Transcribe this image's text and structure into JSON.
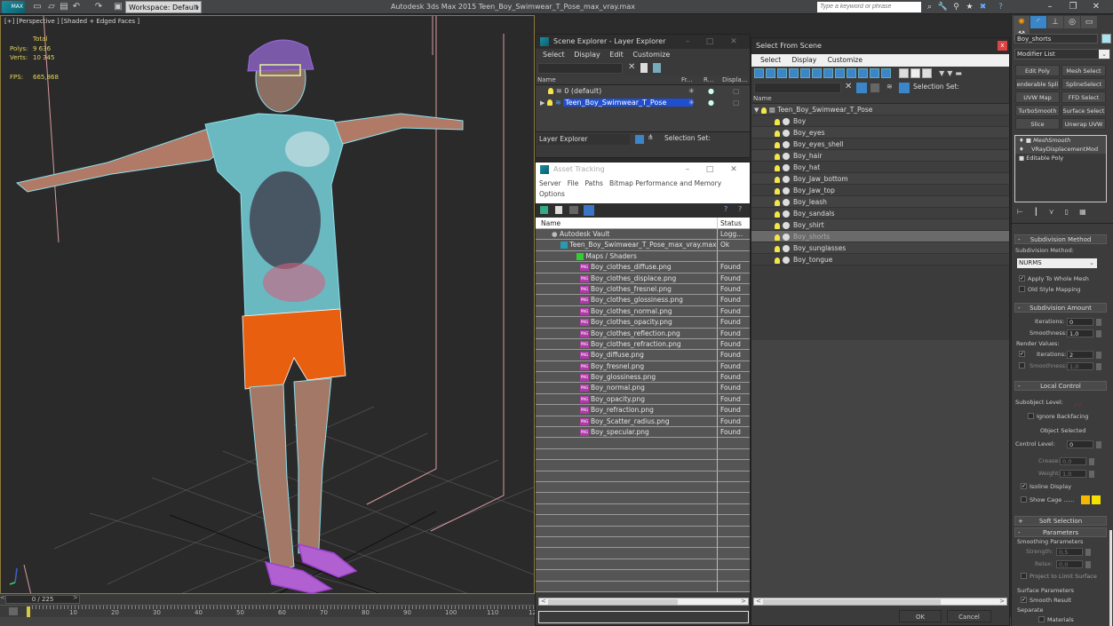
{
  "titlebar": {
    "logo": "MAX",
    "workspace": "Workspace: Default",
    "app_title": "Autodesk 3ds Max  2015     Teen_Boy_Swimwear_T_Pose_max_vray.max",
    "search_placeholder": "Type a keyword or phrase",
    "tool_icons": [
      "binoculars-icon",
      "wrench-icon",
      "satellite-icon",
      "star-icon",
      "exchange-icon",
      "help-icon"
    ],
    "window_controls": [
      "–",
      "❐",
      "✕"
    ]
  },
  "viewport": {
    "label": "[+] [Perspective ] [Shaded + Edged Faces ]",
    "stats": {
      "header": "Total",
      "polys_label": "Polys:",
      "polys": "9 636",
      "verts_label": "Verts:",
      "verts": "10 345",
      "fps_label": "FPS:",
      "fps": "665,868"
    },
    "colors": {
      "shorts": "#e8600f",
      "wire": "#7fe0ee",
      "sandals": "#a040d0",
      "skin": "#b0806a"
    }
  },
  "timeline": {
    "frame": "0 / 225",
    "ticks": [
      "10",
      "20",
      "30",
      "40",
      "50",
      "60",
      "70",
      "80",
      "90",
      "100",
      "110",
      "12"
    ]
  },
  "scene_explorer": {
    "title": "Scene Explorer - Layer Explorer",
    "menu": [
      "Select",
      "Display",
      "Edit",
      "Customize"
    ],
    "columns": [
      "Name",
      "Fr...",
      "R...",
      "Displa..."
    ],
    "rows": [
      {
        "name": "0 (default)",
        "selected": false
      },
      {
        "name": "Teen_Boy_Swimwear_T_Pose",
        "selected": true
      }
    ],
    "footer_dropdown": "Layer Explorer",
    "selection_set_label": "Selection Set:"
  },
  "asset_tracking": {
    "title": "Asset Tracking",
    "menu": [
      "Server",
      "File",
      "Paths",
      "Bitmap Performance and Memory",
      "Options"
    ],
    "columns": [
      "Name",
      "Status"
    ],
    "rows": [
      {
        "name": "Autodesk Vault",
        "status": "Logg...",
        "level": 0,
        "icon": "vault-icon"
      },
      {
        "name": "Teen_Boy_Swimwear_T_Pose_max_vray.max",
        "status": "Ok",
        "level": 1,
        "icon": "max-file-icon"
      },
      {
        "name": "Maps / Shaders",
        "status": "",
        "level": 2,
        "icon": "maps-icon"
      },
      {
        "name": "Boy_clothes_diffuse.png",
        "status": "Found",
        "level": 3,
        "icon": "png-icon"
      },
      {
        "name": "Boy_clothes_displace.png",
        "status": "Found",
        "level": 3,
        "icon": "png-icon"
      },
      {
        "name": "Boy_clothes_fresnel.png",
        "status": "Found",
        "level": 3,
        "icon": "png-icon"
      },
      {
        "name": "Boy_clothes_glossiness.png",
        "status": "Found",
        "level": 3,
        "icon": "png-icon"
      },
      {
        "name": "Boy_clothes_normal.png",
        "status": "Found",
        "level": 3,
        "icon": "png-icon"
      },
      {
        "name": "Boy_clothes_opacity.png",
        "status": "Found",
        "level": 3,
        "icon": "png-icon"
      },
      {
        "name": "Boy_clothes_reflection.png",
        "status": "Found",
        "level": 3,
        "icon": "png-icon"
      },
      {
        "name": "Boy_clothes_refraction.png",
        "status": "Found",
        "level": 3,
        "icon": "png-icon"
      },
      {
        "name": "Boy_diffuse.png",
        "status": "Found",
        "level": 3,
        "icon": "png-icon"
      },
      {
        "name": "Boy_fresnel.png",
        "status": "Found",
        "level": 3,
        "icon": "png-icon"
      },
      {
        "name": "Boy_glossiness.png",
        "status": "Found",
        "level": 3,
        "icon": "png-icon"
      },
      {
        "name": "Boy_normal.png",
        "status": "Found",
        "level": 3,
        "icon": "png-icon"
      },
      {
        "name": "Boy_opacity.png",
        "status": "Found",
        "level": 3,
        "icon": "png-icon"
      },
      {
        "name": "Boy_refraction.png",
        "status": "Found",
        "level": 3,
        "icon": "png-icon"
      },
      {
        "name": "Boy_Scatter_radius.png",
        "status": "Found",
        "level": 3,
        "icon": "png-icon"
      },
      {
        "name": "Boy_specular.png",
        "status": "Found",
        "level": 3,
        "icon": "png-icon"
      }
    ],
    "empty_rows": 14
  },
  "select_from_scene": {
    "title": "Select From Scene",
    "menu": [
      "Select",
      "Display",
      "Customize"
    ],
    "selection_set_label": "Selection Set:",
    "column": "Name",
    "root": "Teen_Boy_Swimwear_T_Pose",
    "items": [
      {
        "name": "Boy",
        "selected": false
      },
      {
        "name": "Boy_eyes",
        "selected": false
      },
      {
        "name": "Boy_eyes_shell",
        "selected": false
      },
      {
        "name": "Boy_hair",
        "selected": false
      },
      {
        "name": "Boy_hat",
        "selected": false
      },
      {
        "name": "Boy_Jaw_bottom",
        "selected": false
      },
      {
        "name": "Boy_Jaw_top",
        "selected": false
      },
      {
        "name": "Boy_leash",
        "selected": false
      },
      {
        "name": "Boy_sandals",
        "selected": false
      },
      {
        "name": "Boy_shirt",
        "selected": false
      },
      {
        "name": "Boy_shorts",
        "selected": true
      },
      {
        "name": "Boy_sunglasses",
        "selected": false
      },
      {
        "name": "Boy_tongue",
        "selected": false
      }
    ],
    "ok": "OK",
    "cancel": "Cancel"
  },
  "command_panel": {
    "tabs": [
      "create-icon",
      "modify-icon",
      "hierarchy-icon",
      "motion-icon",
      "display-icon",
      "utilities-icon"
    ],
    "object_name": "Boy_shorts",
    "object_color": "#a8e4f0",
    "modifier_list": "Modifier List",
    "modifier_buttons": [
      "Edit Poly",
      "Mesh Select",
      "enderable Spli",
      "SplineSelect",
      "UVW Map",
      "FFD Select",
      "TurboSmooth",
      "Surface Select",
      "Slice",
      "Unwrap UVW"
    ],
    "stack": [
      "MeshSmooth",
      "VRayDisplacementMod",
      "Editable Poly"
    ],
    "subdivision_method": {
      "title": "Subdivision Method",
      "label": "Subdivision Method:",
      "value": "NURMS",
      "apply_whole_mesh": "Apply To Whole Mesh",
      "apply_whole_mesh_checked": true,
      "old_style": "Old Style Mapping",
      "old_style_checked": false
    },
    "subdivision_amount": {
      "title": "Subdivision Amount",
      "iterations_label": "Iterations:",
      "iterations": "0",
      "smoothness_label": "Smoothness:",
      "smoothness": "1,0",
      "render_values": "Render Values:",
      "r_iterations": "2",
      "r_iterations_checked": true,
      "r_smoothness": "1,0",
      "r_smoothness_checked": false
    },
    "local_control": {
      "title": "Local Control",
      "subobject_level": "Subobject Level:",
      "ignore_backfacing": "Ignore Backfacing",
      "object_selected": "Object Selected",
      "control_level_label": "Control Level:",
      "control_level": "0",
      "crease_label": "Crease:",
      "crease": "0,0",
      "weight_label": "Weight:",
      "weight": "1,0",
      "isoline": "Isoline Display",
      "isoline_checked": true,
      "show_cage": "Show Cage ......",
      "show_cage_checked": false,
      "cage_colors": [
        "#f5b800",
        "#f5e000"
      ]
    },
    "soft_selection": "Soft Selection",
    "parameters": {
      "title": "Parameters",
      "smoothing": "Smoothing Parameters",
      "strength_label": "Strength:",
      "strength": "0,5",
      "relax_label": "Relax:",
      "relax": "0,0",
      "project": "Project to Limit Surface",
      "surface": "Surface Parameters",
      "smooth_result": "Smooth Result",
      "separate": "Separate",
      "materials": "Materials"
    }
  }
}
